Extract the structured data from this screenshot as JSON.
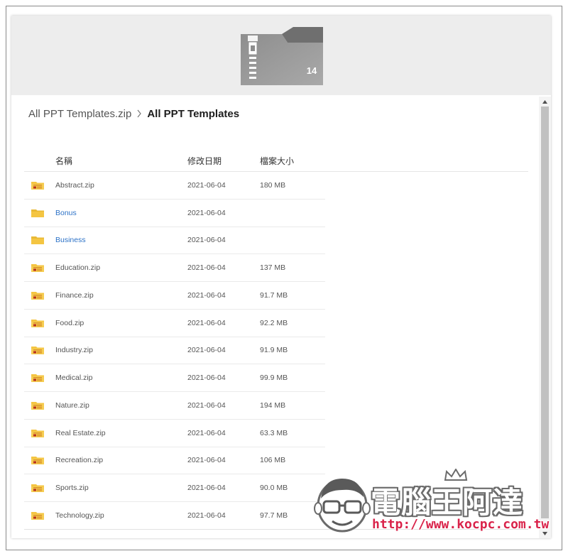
{
  "archive_thumbnail": {
    "count": "14"
  },
  "breadcrumb": {
    "parent": "All PPT Templates.zip",
    "current": "All PPT Templates"
  },
  "columns": {
    "name": "名稱",
    "date": "修改日期",
    "size": "檔案大小"
  },
  "rows": [
    {
      "name": "Abstract.zip",
      "date": "2021-06-04",
      "size": "180 MB",
      "kind": "zip"
    },
    {
      "name": "Bonus",
      "date": "2021-06-04",
      "size": "",
      "kind": "folder"
    },
    {
      "name": "Business",
      "date": "2021-06-04",
      "size": "",
      "kind": "folder"
    },
    {
      "name": "Education.zip",
      "date": "2021-06-04",
      "size": "137 MB",
      "kind": "zip"
    },
    {
      "name": "Finance.zip",
      "date": "2021-06-04",
      "size": "91.7 MB",
      "kind": "zip"
    },
    {
      "name": "Food.zip",
      "date": "2021-06-04",
      "size": "92.2 MB",
      "kind": "zip"
    },
    {
      "name": "Industry.zip",
      "date": "2021-06-04",
      "size": "91.9 MB",
      "kind": "zip"
    },
    {
      "name": "Medical.zip",
      "date": "2021-06-04",
      "size": "99.9 MB",
      "kind": "zip"
    },
    {
      "name": "Nature.zip",
      "date": "2021-06-04",
      "size": "194 MB",
      "kind": "zip"
    },
    {
      "name": "Real Estate.zip",
      "date": "2021-06-04",
      "size": "63.3 MB",
      "kind": "zip"
    },
    {
      "name": "Recreation.zip",
      "date": "2021-06-04",
      "size": "106 MB",
      "kind": "zip"
    },
    {
      "name": "Sports.zip",
      "date": "2021-06-04",
      "size": "90.0 MB",
      "kind": "zip"
    },
    {
      "name": "Technology.zip",
      "date": "2021-06-04",
      "size": "97.7 MB",
      "kind": "zip"
    }
  ],
  "watermark": {
    "title": "電腦王阿達",
    "url": "http://www.kocpc.com.tw"
  },
  "colors": {
    "folder_link": "#2c72c7",
    "folder_icon": "#f4c542",
    "header_bg": "#ededed",
    "url_red": "#d9234a"
  }
}
